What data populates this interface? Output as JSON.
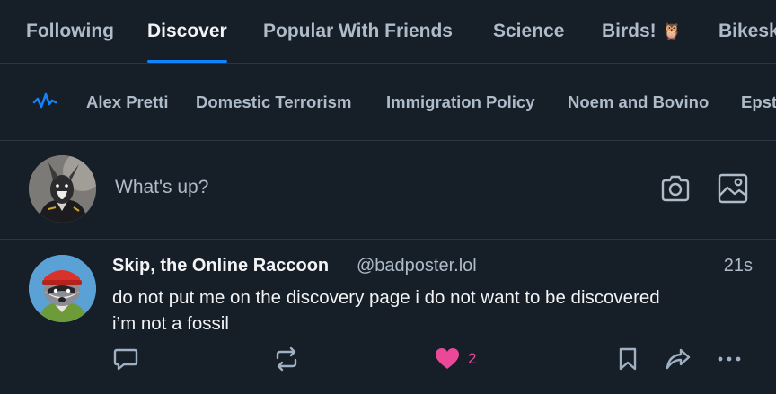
{
  "tabs": [
    {
      "label": "Following"
    },
    {
      "label": "Discover",
      "active": true
    },
    {
      "label": "Popular With Friends"
    },
    {
      "label": "Science"
    },
    {
      "label": "Birds!",
      "emoji": "🦉"
    },
    {
      "label": "Bikesk"
    }
  ],
  "trending_icon": "trending-wave-icon",
  "topics": [
    "Alex Pretti",
    "Domestic Terrorism",
    "Immigration Policy",
    "Noem and Bovino",
    "Epst"
  ],
  "composer": {
    "placeholder": "What's up?",
    "icons": [
      "camera-icon",
      "image-icon"
    ]
  },
  "post": {
    "author": "Skip, the Online Raccoon",
    "handle": "@badposter.lol",
    "time": "21s",
    "text_line1": "do not put me on the discovery page i do not want to be discovered",
    "text_line2": "i’m not a fossil",
    "like_count": "2",
    "actions": [
      "reply-icon",
      "repost-icon",
      "heart-icon",
      "bookmark-icon",
      "share-icon",
      "more-icon"
    ]
  },
  "colors": {
    "background": "#161e27",
    "accent": "#1083fe",
    "like": "#ec4899",
    "muted_text": "#aebbc9",
    "divider": "#2a3644"
  }
}
